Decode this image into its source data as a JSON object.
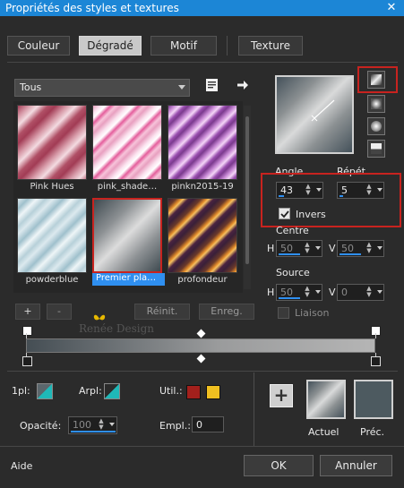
{
  "window": {
    "title": "Propriétés des styles et textures",
    "close_glyph": "✕"
  },
  "tabs": [
    {
      "label": "Couleur",
      "active": false
    },
    {
      "label": "Dégradé",
      "active": true
    },
    {
      "label": "Motif",
      "active": false
    },
    {
      "label": "Texture",
      "active": false
    }
  ],
  "preset_select": {
    "value": "Tous"
  },
  "gallery": {
    "items": [
      {
        "label": "Pink Hues",
        "selected": false
      },
      {
        "label": "pink_shade…",
        "selected": false
      },
      {
        "label": "pinkn2015-19",
        "selected": false
      },
      {
        "label": "powderblue",
        "selected": false
      },
      {
        "label": "Premier pla…",
        "selected": true
      },
      {
        "label": "profondeur",
        "selected": false
      }
    ]
  },
  "gallery_buttons": {
    "add": "+",
    "remove": "-",
    "reset": "Réinit.",
    "save": "Enreg."
  },
  "watermark": {
    "text": "Renée Design"
  },
  "gradient": {
    "angle_label": "Angle",
    "angle_value": "43",
    "repeat_label": "Répét.",
    "repeat_value": "5",
    "invert_label": "Invers",
    "invert_checked": true,
    "center_label": "Centre",
    "center_h": "50",
    "center_v": "50",
    "source_label": "Source",
    "source_h": "50",
    "source_v": "0",
    "h_label": "H",
    "v_label": "V",
    "link_label": "Liaison"
  },
  "bottom": {
    "first_label": "1pl:",
    "arrow_label": "Arpl:",
    "util_label": "Util.:",
    "opacity_label": "Opacité:",
    "opacity_value": "100",
    "empl_label": "Empl.:",
    "empl_value": "0",
    "current_label": "Actuel",
    "previous_label": "Préc.",
    "add_glyph": "+",
    "help_label": "Aide",
    "ok_label": "OK",
    "cancel_label": "Annuler"
  },
  "colors": {
    "accent": "#2f8ff0",
    "title_bar": "#1c86d6",
    "highlight_red": "#c8231f",
    "util_color_1": "#a3201c",
    "util_color_2": "#f0c020",
    "teal": "#1fb8b8",
    "previous_color": "#4d5a60"
  }
}
